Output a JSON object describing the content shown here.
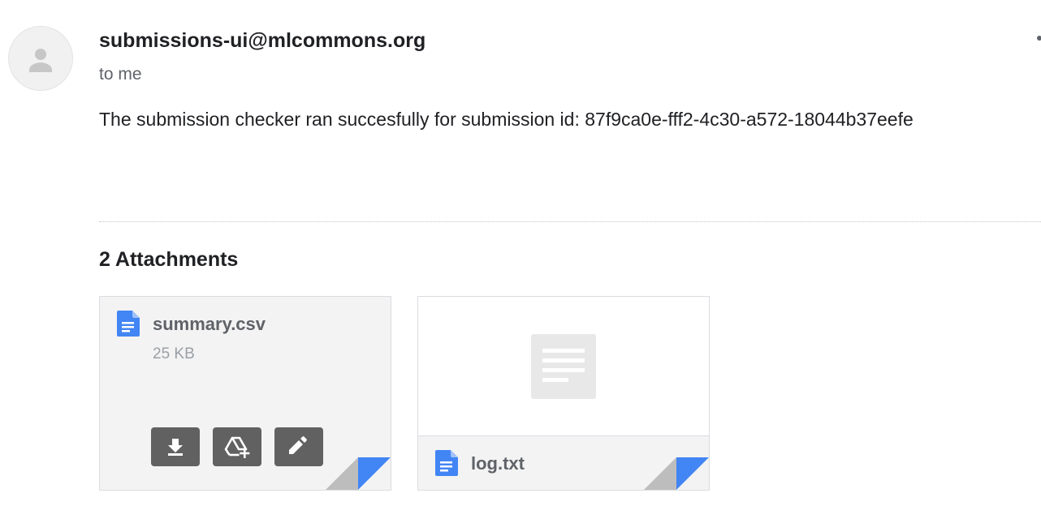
{
  "message": {
    "sender": "submissions-ui@mlcommons.org",
    "recipient": "to me",
    "body": "The submission checker ran succesfully for submission id: 87f9ca0e-fff2-4c30-a572-18044b37eefe"
  },
  "attachments": {
    "heading": "2 Attachments",
    "items": [
      {
        "name": "summary.csv",
        "size": "25 KB",
        "icon": "google-docs-icon",
        "actions": [
          "download-icon",
          "add-to-drive-icon",
          "edit-icon"
        ]
      },
      {
        "name": "log.txt",
        "icon": "google-docs-icon",
        "preview": "document-thumbnail-icon"
      }
    ]
  },
  "colors": {
    "accent_blue": "#4285f4",
    "corner_gray": "#bdbdbd",
    "action_button": "#616161"
  }
}
